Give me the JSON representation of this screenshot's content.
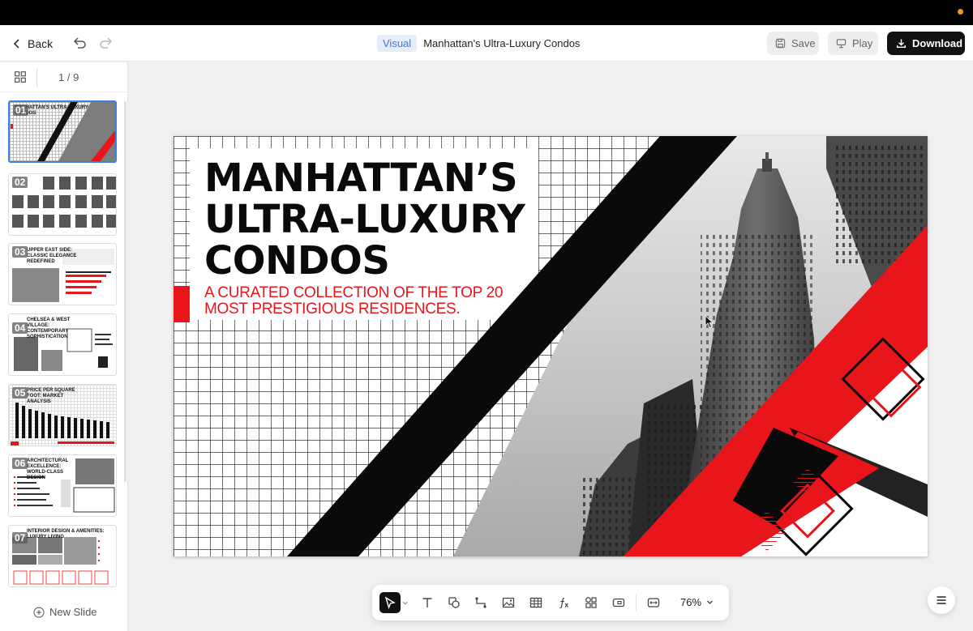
{
  "header": {
    "back_label": "Back",
    "badge": "Visual",
    "title": "Manhattan's Ultra-Luxury Condos",
    "save_label": "Save",
    "play_label": "Play",
    "download_label": "Download"
  },
  "sidebar": {
    "page_counter": "1 / 9",
    "new_slide_label": "New Slide",
    "thumbnails": [
      {
        "num": "01",
        "title": "MANHATTAN'S ULTRA-LUXURY CONDOS"
      },
      {
        "num": "02",
        "title": ""
      },
      {
        "num": "03",
        "title": "UPPER EAST SIDE: CLASSIC ELEGANCE REDEFINED"
      },
      {
        "num": "04",
        "title": "CHELSEA & WEST VILLAGE: CONTEMPORARY SOPHISTICATION"
      },
      {
        "num": "05",
        "title": "PRICE PER SQUARE FOOT: MARKET ANALYSIS"
      },
      {
        "num": "06",
        "title": "ARCHITECTURAL EXCELLENCE: WORLD-CLASS DESIGN"
      },
      {
        "num": "07",
        "title": "INTERIOR DESIGN & AMENITIES: LUXURY LIVING"
      }
    ]
  },
  "slide": {
    "title": "MANHATTAN’S\nULTRA-LUXURY\nCONDOS",
    "subtitle": "A CURATED COLLECTION OF THE TOP 20\nMOST PRESTIGIOUS RESIDENCES."
  },
  "toolbar": {
    "zoom": "76%",
    "tools": [
      "pointer-icon",
      "text-icon",
      "shape-icon",
      "connector-icon",
      "image-icon",
      "table-icon",
      "formula-icon",
      "components-icon",
      "media-icon",
      "fit-icon"
    ]
  },
  "colors": {
    "accent_red": "#e8151b",
    "download_bg": "#111111",
    "badge_bg": "#e4edf9",
    "badge_text": "#3d7bd9",
    "selected_border": "#3b7fe0"
  }
}
